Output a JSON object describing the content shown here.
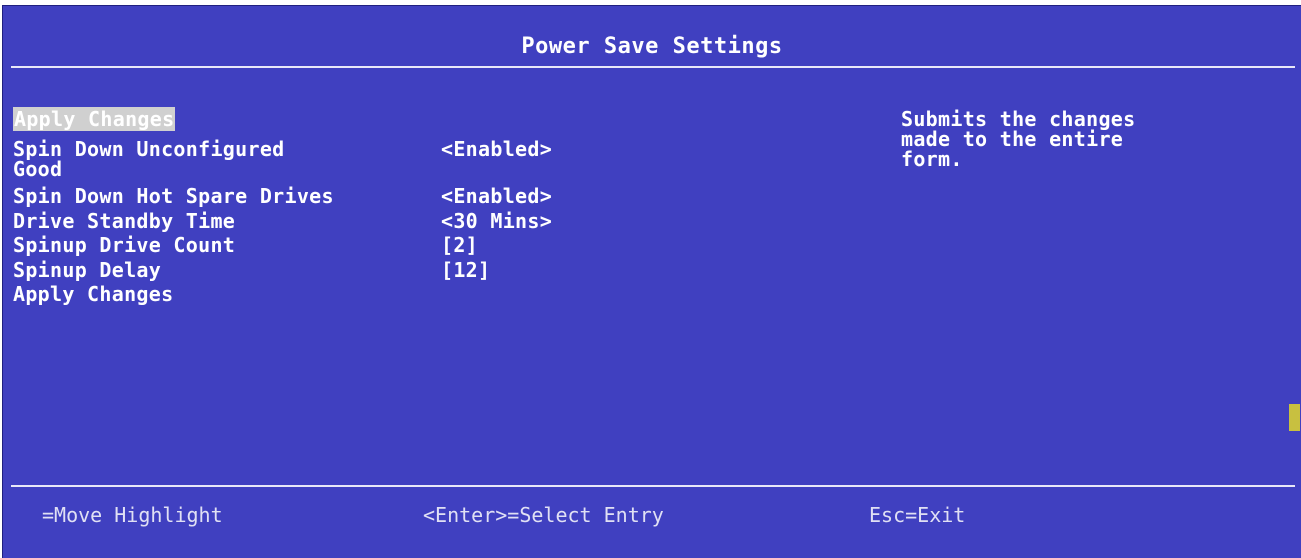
{
  "header": {
    "title": "Power Save Settings"
  },
  "menu": {
    "items": [
      {
        "label": "Apply Changes",
        "value": ""
      },
      {
        "label": "Spin Down Unconfigured",
        "label_line2": "Good",
        "value": "<Enabled>"
      },
      {
        "label": "Spin Down Hot Spare Drives",
        "value": "<Enabled>"
      },
      {
        "label": "Drive Standby Time",
        "value": "<30 Mins>"
      },
      {
        "label": "Spinup Drive Count",
        "value": "[2]"
      },
      {
        "label": "Spinup Delay",
        "value": "[12]"
      },
      {
        "label": "Apply Changes",
        "value": ""
      }
    ],
    "selected_index": 0
  },
  "help": {
    "text": "Submits the changes\nmade to the entire\nform."
  },
  "footer": {
    "move": "=Move Highlight",
    "enter": "<Enter>=Select Entry",
    "exit": "Esc=Exit"
  },
  "colors": {
    "background": "#4040c0",
    "text": "#ffffff",
    "highlight": "#d0d0d0",
    "scroll_thumb": "#c8c040"
  }
}
